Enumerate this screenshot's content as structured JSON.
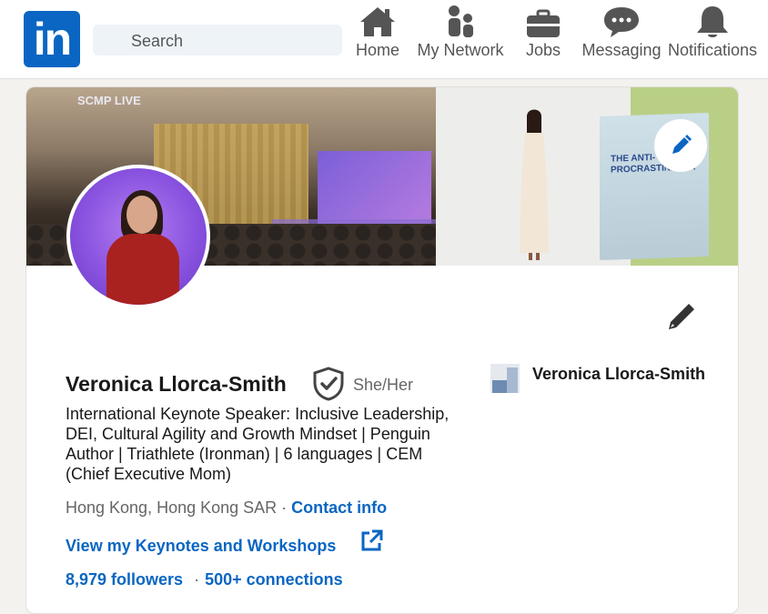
{
  "nav": {
    "logo_text": "in",
    "search_placeholder": "Search",
    "items": [
      {
        "label": "Home",
        "icon": "home-icon"
      },
      {
        "label": "My Network",
        "icon": "network-icon"
      },
      {
        "label": "Jobs",
        "icon": "briefcase-icon"
      },
      {
        "label": "Messaging",
        "icon": "messaging-icon"
      },
      {
        "label": "Notifications",
        "icon": "bell-icon"
      }
    ]
  },
  "banner": {
    "venue_sign": "SCMP LIVE",
    "book_title": "THE ANTI-PROCRASTINATOR"
  },
  "profile": {
    "name": "Veronica Llorca-Smith",
    "pronouns": "She/Her",
    "headline": "International Keynote Speaker: Inclusive Leadership, DEI, Cultural Agility and Growth Mindset | Penguin Author | Triathlete (Ironman) | 6 languages | CEM (Chief Executive Mom)",
    "location": "Hong Kong, Hong Kong SAR",
    "location_separator": " · ",
    "contact_info": "Contact info",
    "featured_link": "View my Keynotes and Workshops",
    "followers": "8,979 followers",
    "stats_separator": "·",
    "connections": "500+ connections",
    "current_company": "Veronica Llorca-Smith"
  },
  "colors": {
    "brand": "#0a66c2",
    "page_bg": "#f3f2ef",
    "text_secondary": "#666666"
  }
}
